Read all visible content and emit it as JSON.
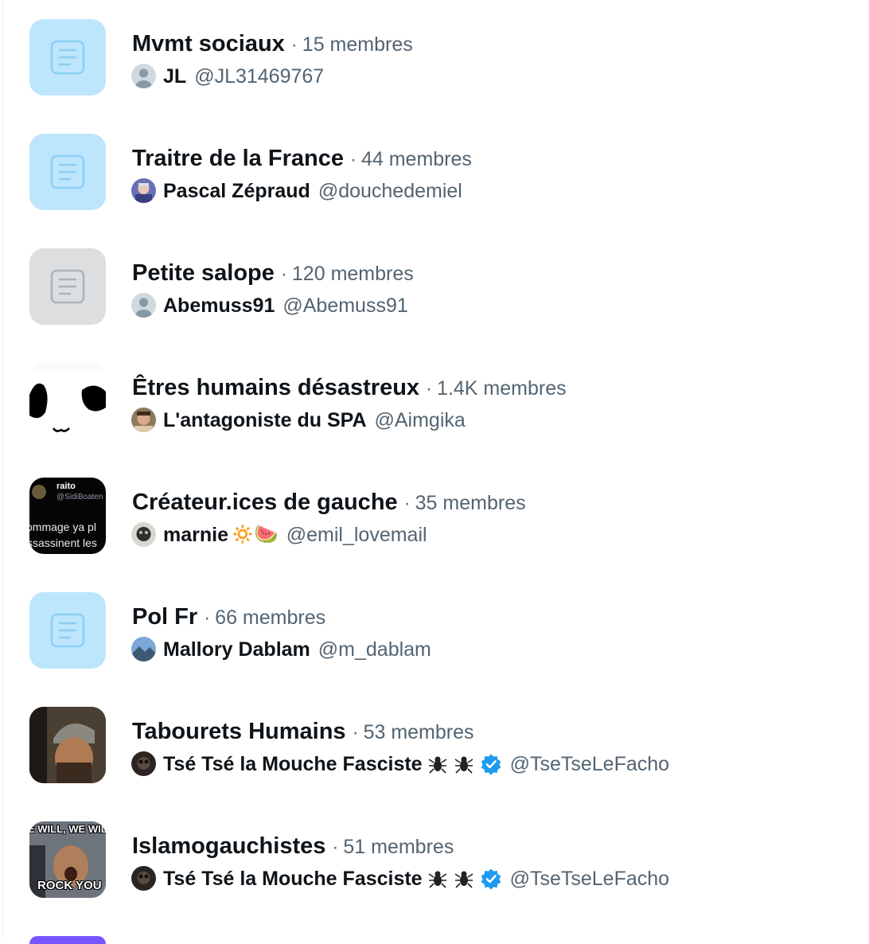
{
  "lists": [
    {
      "name": "Mvmt sociaux",
      "separator": "·",
      "members": "15 membres",
      "owner": {
        "name": "JL",
        "handle": "@JL31469767"
      },
      "thumb": "blue-doc-icon",
      "avatar": "default-avatar"
    },
    {
      "name": "Traitre de la France",
      "separator": "·",
      "members": "44 membres",
      "owner": {
        "name": "Pascal Zépraud",
        "handle": "@douchedemiel"
      },
      "thumb": "blue-doc-icon",
      "avatar": "photo"
    },
    {
      "name": "Petite salope",
      "separator": "·",
      "members": "120 membres",
      "owner": {
        "name": "Abemuss91",
        "handle": "@Abemuss91"
      },
      "thumb": "grey-doc-icon",
      "avatar": "default-avatar"
    },
    {
      "name": "Êtres humains désastreux",
      "separator": "·",
      "members": "1.4K membres",
      "owner": {
        "name": "L'antagoniste du SPA",
        "handle": "@Aimgika"
      },
      "thumb": "face-image",
      "avatar": "photo"
    },
    {
      "name": "Créateur.ices de gauche",
      "separator": "·",
      "members": "35 membres",
      "owner": {
        "name": "marnie",
        "emojis": "🔅🍉",
        "handle": "@emil_lovemail"
      },
      "thumb": "tweet-screenshot",
      "avatar": "photo",
      "thumb_text": {
        "user": "raito",
        "handle": "@SidiBoaten",
        "line1": "ommage ya pl",
        "line2": "ssassinent les"
      }
    },
    {
      "name": "Pol Fr",
      "separator": "·",
      "members": "66 membres",
      "owner": {
        "name": "Mallory Dablam",
        "handle": "@m_dablam"
      },
      "thumb": "blue-doc-icon",
      "avatar": "photo"
    },
    {
      "name": "Tabourets Humains",
      "separator": "·",
      "members": "53 membres",
      "owner": {
        "name": "Tsé Tsé la Mouche Fasciste",
        "handle": "@TseTseLeFacho"
      },
      "thumb": "beanie-photo",
      "avatar": "photo",
      "verified": true
    },
    {
      "name": "Islamogauchistes",
      "separator": "·",
      "members": "51 membres",
      "owner": {
        "name": "Tsé Tsé la Mouche Fasciste",
        "handle": "@TseTseLeFacho"
      },
      "thumb": "meme-image",
      "avatar": "photo",
      "verified": true,
      "thumb_text": {
        "top": "E WILL, WE WIL",
        "bottom": "ROCK YOU"
      }
    }
  ],
  "colors": {
    "text": "#0f1419",
    "secondary": "#536471",
    "blue_thumb": "#bde6fd",
    "grey_thumb": "#dcdedf",
    "verified": "#1d9bf0"
  }
}
